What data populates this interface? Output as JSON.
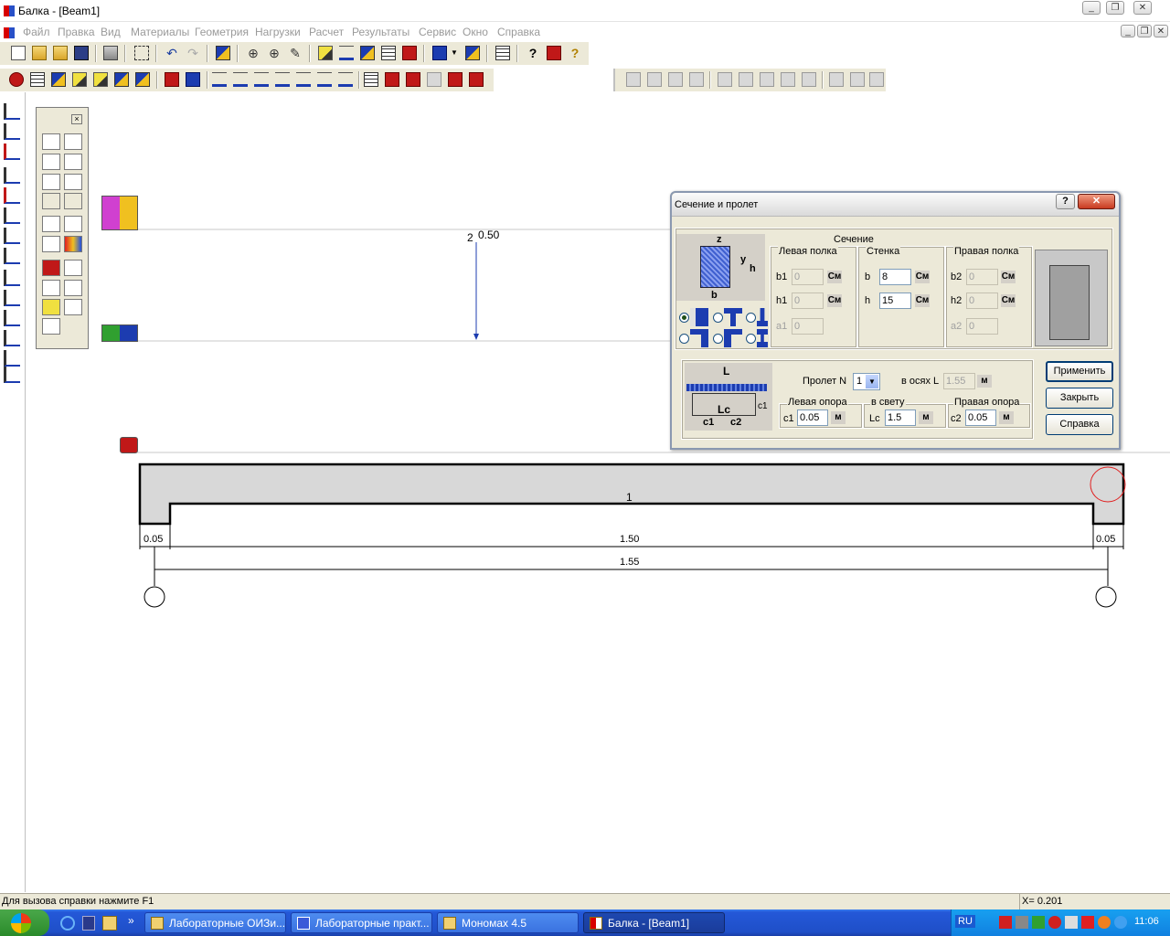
{
  "window": {
    "title": "Балка - [Beam1]"
  },
  "menu": [
    "Файл",
    "Правка",
    "Вид",
    "Материалы",
    "Геометрия",
    "Нагрузки",
    "Расчет",
    "Результаты",
    "Сервис",
    "Окно",
    "Справка"
  ],
  "canvas": {
    "node_label_2": "2",
    "load_value": "0.50",
    "span_number": "1",
    "dim_left": "0.05",
    "dim_clear": "1.50",
    "dim_right": "0.05",
    "dim_total": "1.55"
  },
  "dialog": {
    "title": "Сечение и пролет",
    "help_btn": "?",
    "close_btn": "✕",
    "section_title": "Сечение",
    "left_flange_title": "Левая полка",
    "web_title": "Стенка",
    "right_flange_title": "Правая полка",
    "b1_label": "b1",
    "b1_value": "0",
    "h1_label": "h1",
    "h1_value": "0",
    "a1_label": "a1",
    "a1_value": "0",
    "b_label": "b",
    "b_value": "8",
    "h_label": "h",
    "h_value": "15",
    "b2_label": "b2",
    "b2_value": "0",
    "h2_label": "h2",
    "h2_value": "0",
    "a2_label": "a2",
    "a2_value": "0",
    "unit_cm": "См",
    "diag_z": "z",
    "diag_y": "y",
    "diag_h": "h",
    "diag_b": "b",
    "span_label": "Пролет N",
    "span_value": "1",
    "axes_label": "в осях L",
    "axes_value": "1.55",
    "unit_m": "м",
    "left_support_title": "Левая опора",
    "clear_title": "в свету",
    "right_support_title": "Правая опора",
    "c1_label": "c1",
    "c1_value": "0.05",
    "lc_label": "Lc",
    "lc_value": "1.5",
    "c2_label": "c2",
    "c2_value": "0.05",
    "span_diag_L": "L",
    "span_diag_Lc": "Lc",
    "span_diag_c1": "c1",
    "span_diag_c2": "c2",
    "span_diag_c1b": "c1",
    "apply_btn": "Применить",
    "close_dialog_btn": "Закрыть",
    "help_dialog_btn": "Справка"
  },
  "status": {
    "hint": "Для вызова справки нажмите F1",
    "coord": "X= 0.201"
  },
  "taskbar": {
    "tasks": [
      "Лабораторные ОИЗи...",
      "Лабораторные практ...",
      "Мономах 4.5",
      "Балка - [Beam1]"
    ],
    "lang": "RU",
    "time": "11:06",
    "more": "»"
  }
}
